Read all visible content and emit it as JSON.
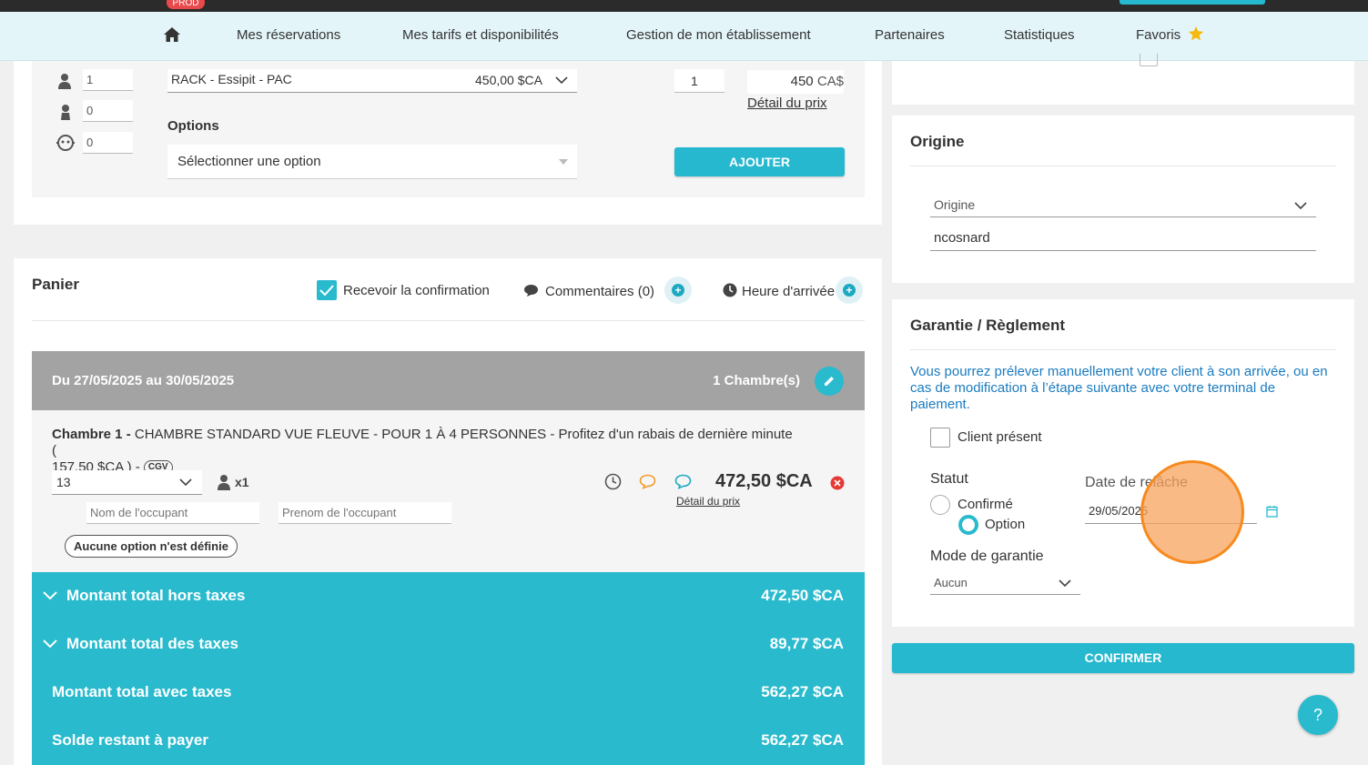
{
  "topbar": {
    "env_badge": "PROD"
  },
  "nav": {
    "items": [
      "Mes réservations",
      "Mes tarifs et disponibilités",
      "Gestion de mon établissement",
      "Partenaires",
      "Statistiques",
      "Favoris"
    ]
  },
  "booking_form": {
    "adults": "1",
    "children": "0",
    "babies": "0",
    "rate_name": "RACK - Essipit - PAC",
    "rate_price": "450,00 $CA",
    "quantity": "1",
    "price_value": "450",
    "price_currency": "CA$",
    "price_detail_link": "Détail du prix",
    "options_label": "Options",
    "options_placeholder": "Sélectionner une option",
    "add_button": "AJOUTER"
  },
  "cart": {
    "title": "Panier",
    "receive_confirmation": "Recevoir la confirmation",
    "comments": "Commentaires (0)",
    "arrival_time": "Heure d'arrivée",
    "stay_dates": "Du 27/05/2025 au 30/05/2025",
    "room_count": "1 Chambre(s)",
    "room_label": "Chambre 1 -",
    "room_description": "CHAMBRE STANDARD VUE FLEUVE - POUR 1 À 4 PERSONNES - Profitez d'un rabais de dernière minute (",
    "room_description_2": "157,50 $CA ) -",
    "cgv_badge": "CGV",
    "room_number": "13",
    "occupants": "x1",
    "room_price": "472,50 $CA",
    "room_price_detail": "Détail du prix",
    "occupant_lastname_placeholder": "Nom de l'occupant",
    "occupant_firstname_placeholder": "Prenom de l'occupant",
    "no_option_badge": "Aucune option n'est définie"
  },
  "totals": [
    {
      "label": "Montant total hors taxes",
      "value": "472,50 $CA",
      "expandable": true
    },
    {
      "label": "Montant total des taxes",
      "value": "89,77 $CA",
      "expandable": true
    },
    {
      "label": "Montant total avec taxes",
      "value": "562,27 $CA",
      "expandable": false
    },
    {
      "label": "Solde restant à payer",
      "value": "562,27 $CA",
      "expandable": false
    }
  ],
  "origin": {
    "title": "Origine",
    "select_value": "Origine",
    "user_value": "ncosnard"
  },
  "guarantee": {
    "title": "Garantie / Règlement",
    "info_text": "Vous pourrez prélever manuellement votre client à son arrivée, ou en cas de modification à l’étape suivante avec votre terminal de paiement.",
    "client_present": "Client présent",
    "status_label": "Statut",
    "status_confirmed": "Confirmé",
    "status_option": "Option",
    "release_date_label": "Date de relâche",
    "release_date": "29/05/2025",
    "mode_label": "Mode de garantie",
    "mode_value": "Aucun"
  },
  "confirm_button": "CONFIRMER",
  "help_button": "?",
  "colors": {
    "accent": "#26b8cf",
    "header_grey": "#a3a3a3",
    "info_blue": "#1a7bbf",
    "delete_red": "#e53935",
    "click_marker": "#f7a35c"
  }
}
